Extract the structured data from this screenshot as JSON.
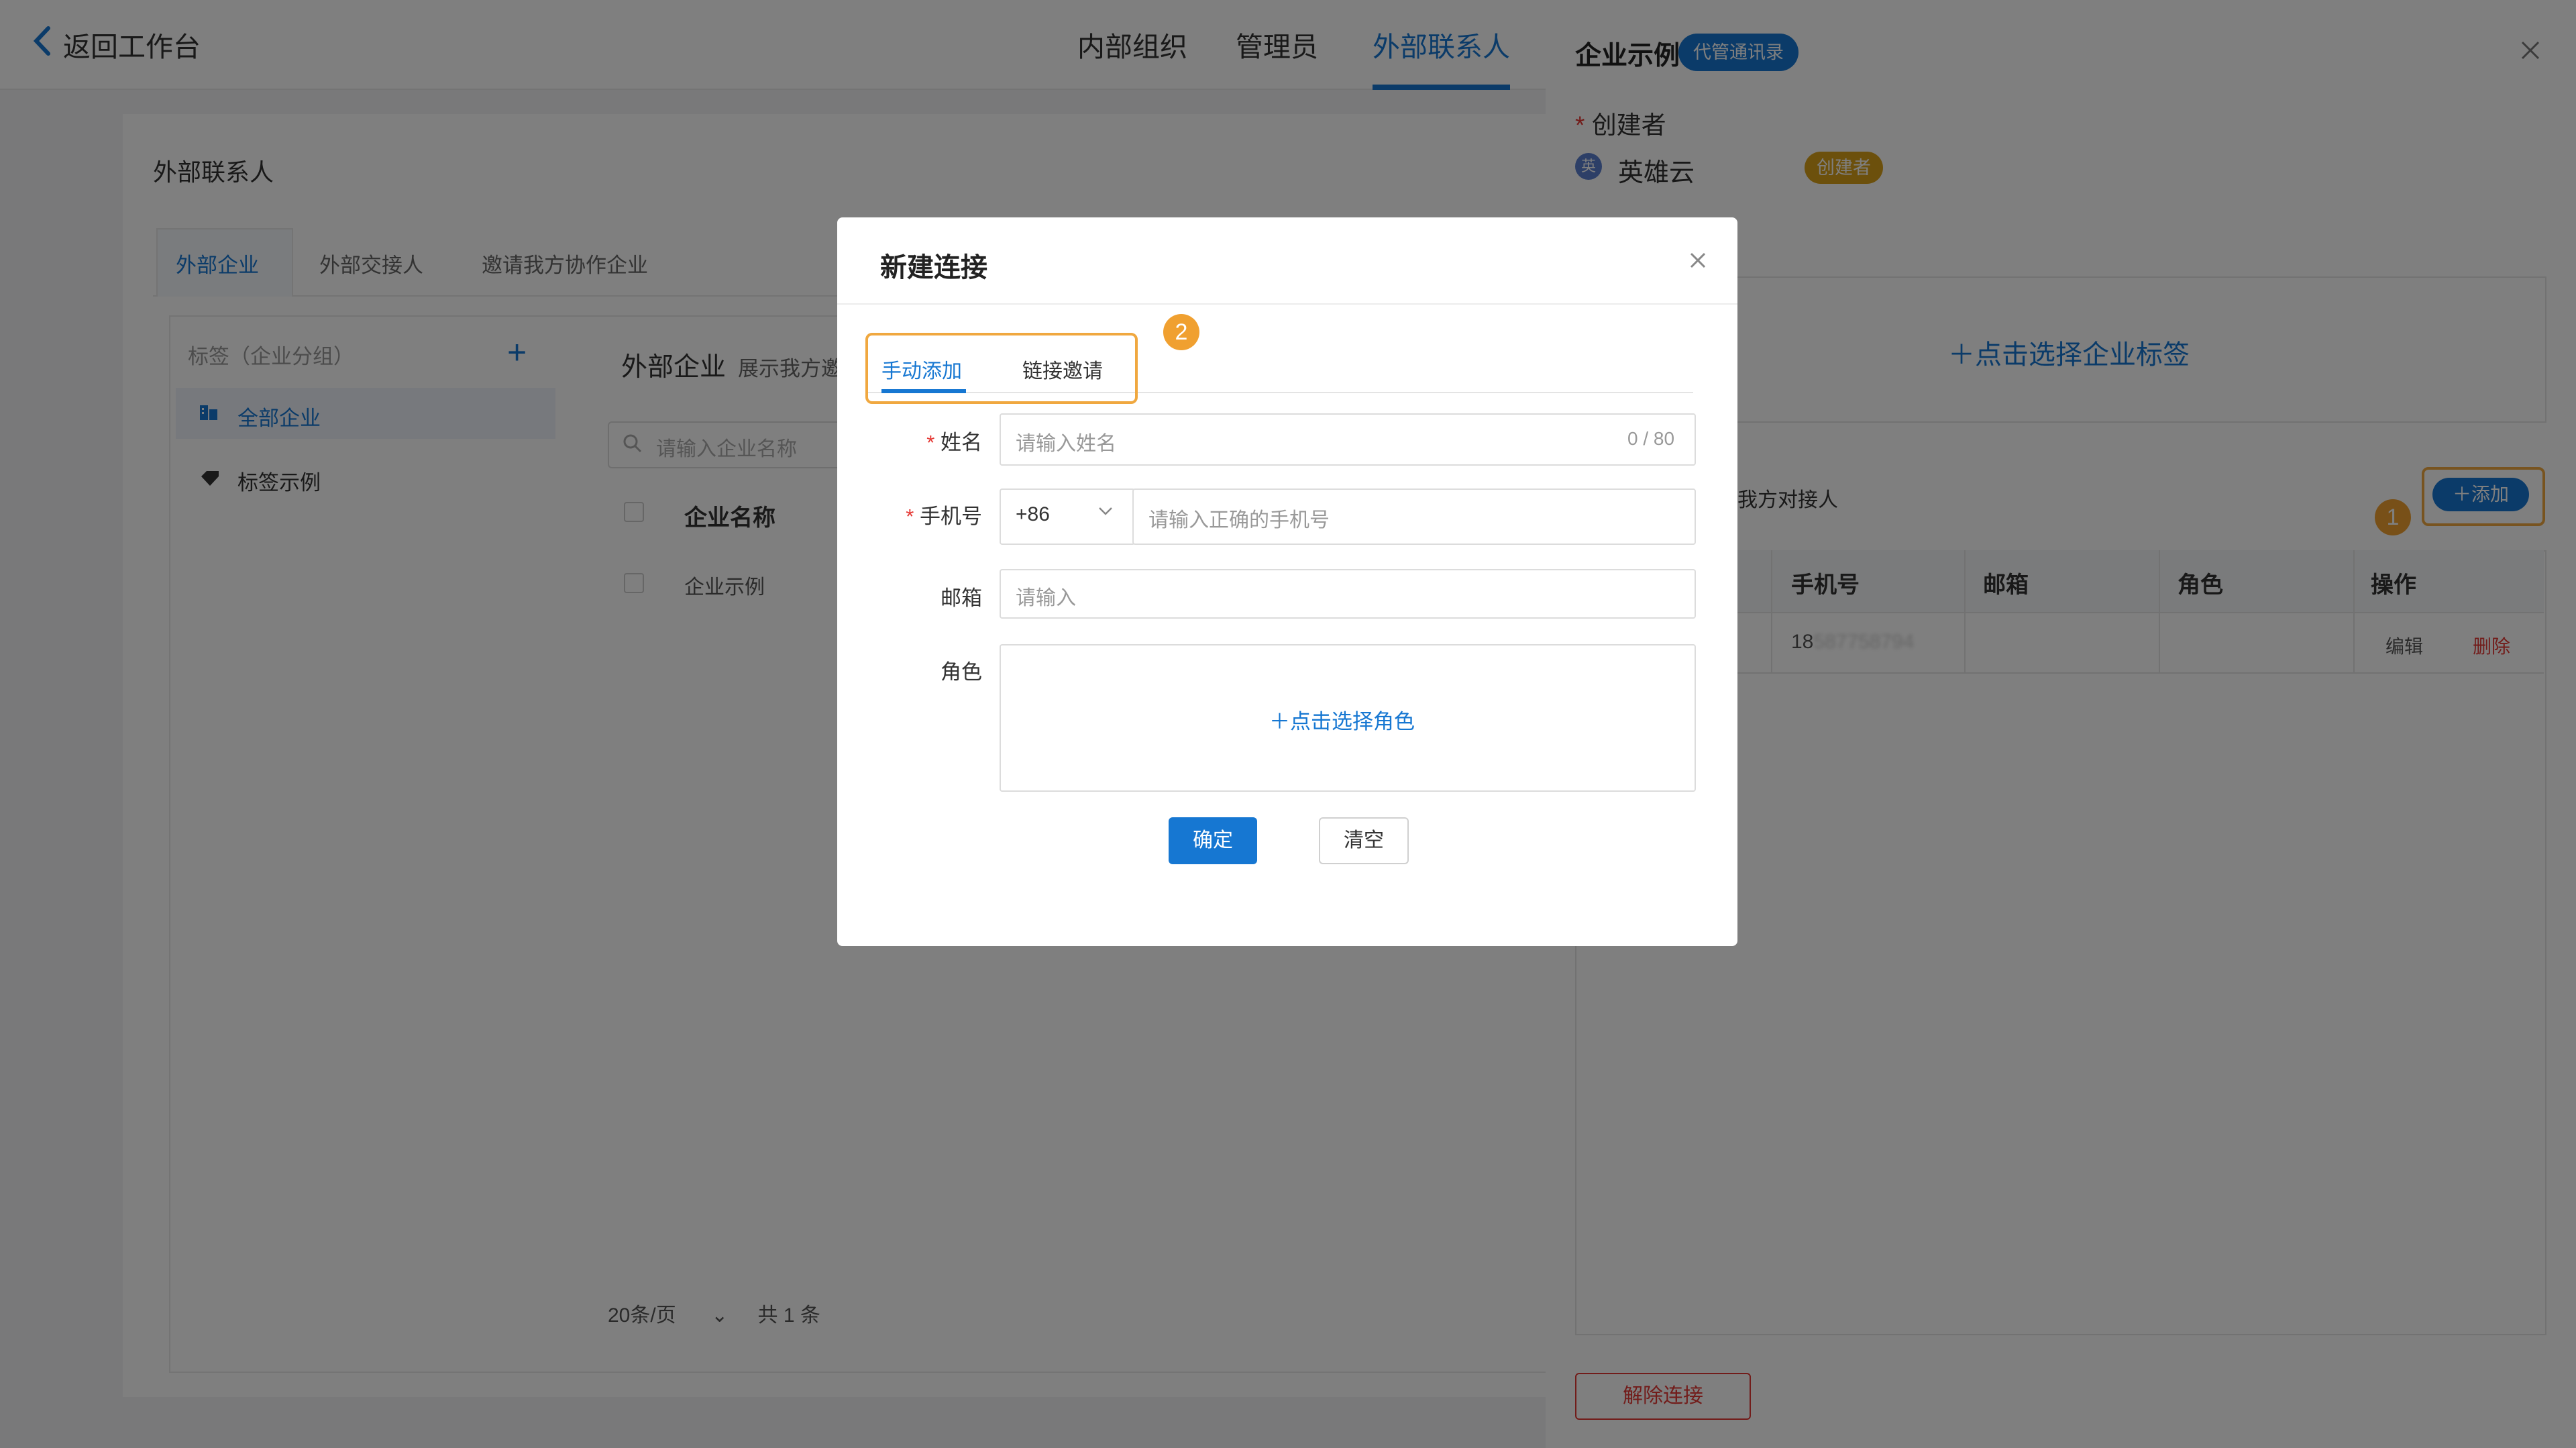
{
  "topbar": {
    "back_label": "返回工作台",
    "tabs": [
      "内部组织",
      "管理员",
      "外部联系人"
    ],
    "active_tab": "外部联系人"
  },
  "main": {
    "page_title": "外部联系人",
    "subtabs": [
      "外部企业",
      "外部交接人",
      "邀请我方协作企业"
    ],
    "tags": {
      "header": "标签（企业分组）",
      "plus": "+",
      "items": [
        "全部企业",
        "标签示例"
      ]
    },
    "content_title": "外部企业",
    "content_sub": "展示我方邀",
    "search_placeholder": "请输入企业名称",
    "table": {
      "header": "企业名称",
      "rows": [
        "企业示例"
      ]
    },
    "pager": {
      "page_size": "20条/页",
      "total": "共 1 条"
    }
  },
  "drawer": {
    "title": "企业示例",
    "badge": "代管通讯录",
    "creator_label": "创建者",
    "avatar_initial": "英",
    "creator_name": "英雄云",
    "creator_badge": "创建者",
    "tag_select": "点击选择企业标签",
    "section_title": "我方对接人",
    "add_button": "添加",
    "columns": [
      "手机号",
      "邮箱",
      "角色",
      "操作"
    ],
    "row": {
      "phone_prefix": "18",
      "phone_masked": "587758794",
      "edit": "编辑",
      "delete": "删除"
    },
    "disconnect": "解除连接"
  },
  "modal": {
    "title": "新建连接",
    "tabs": [
      "手动添加",
      "链接邀请"
    ],
    "fields": {
      "name": {
        "label": "姓名",
        "placeholder": "请输入姓名",
        "counter": "0 / 80"
      },
      "phone": {
        "label": "手机号",
        "country_code": "+86",
        "placeholder": "请输入正确的手机号"
      },
      "email": {
        "label": "邮箱",
        "placeholder": "请输入"
      },
      "role": {
        "label": "角色",
        "select_link": "点击选择角色"
      }
    },
    "confirm": "确定",
    "clear": "清空"
  },
  "annotations": {
    "step1": "1",
    "step2": "2"
  },
  "colors": {
    "primary": "#1677d2",
    "danger": "#e53935",
    "highlight": "#f0a840",
    "creator_badge": "#d9a018"
  },
  "icons": [
    "chevron-left-icon",
    "plus-icon",
    "building-icon",
    "tag-icon",
    "search-icon",
    "close-icon",
    "chevron-down-icon"
  ]
}
